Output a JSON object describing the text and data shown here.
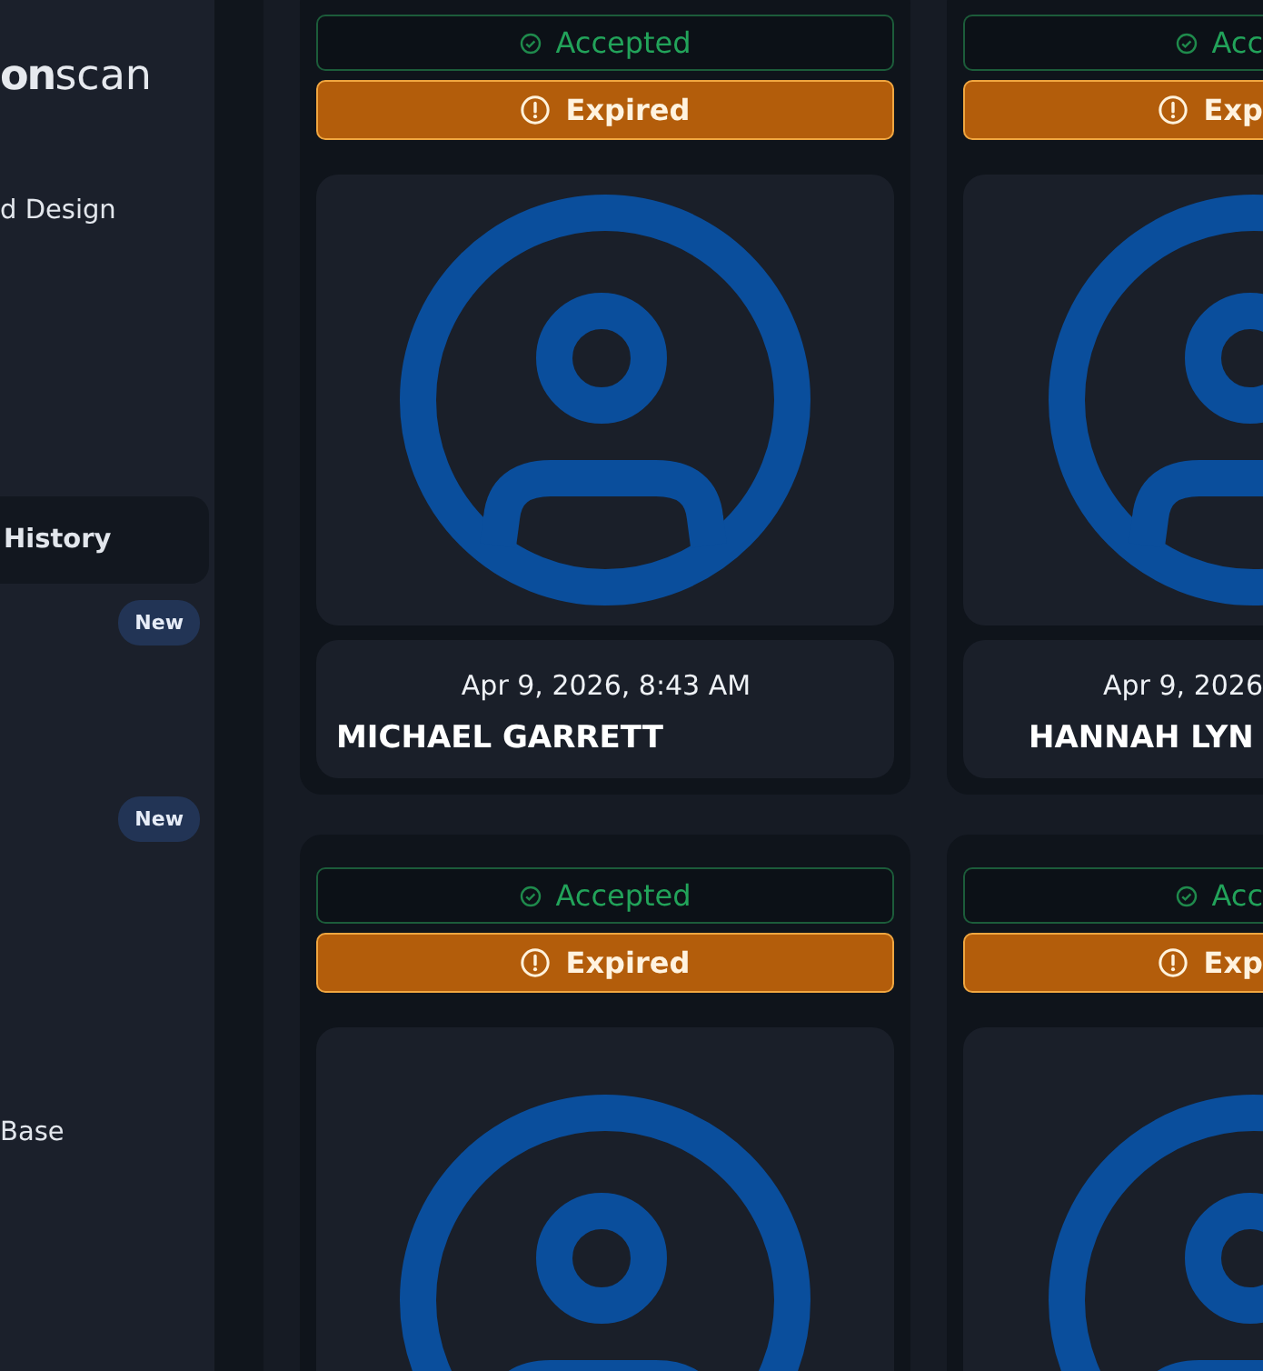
{
  "sidebar": {
    "logo": {
      "bold": "on",
      "light": "scan"
    },
    "items": [
      {
        "label": "d Design",
        "selected": false
      },
      {
        "label": "History",
        "selected": true
      },
      {
        "badge": "New",
        "selected": false
      },
      {
        "badge": "New",
        "selected": false
      },
      {
        "label": "Base",
        "selected": false
      }
    ]
  },
  "cards": [
    {
      "status": "Accepted",
      "alert": "Expired",
      "date": "Apr 9, 2026, 8:43 AM",
      "name": "MICHAEL GARRETT"
    },
    {
      "status": "Acc",
      "alert": "Exp",
      "date": "Apr 9, 2026",
      "name": "HANNAH LYN"
    },
    {
      "status": "Accepted",
      "alert": "Expired"
    },
    {
      "status": "Acc",
      "alert": "Exp"
    }
  ]
}
